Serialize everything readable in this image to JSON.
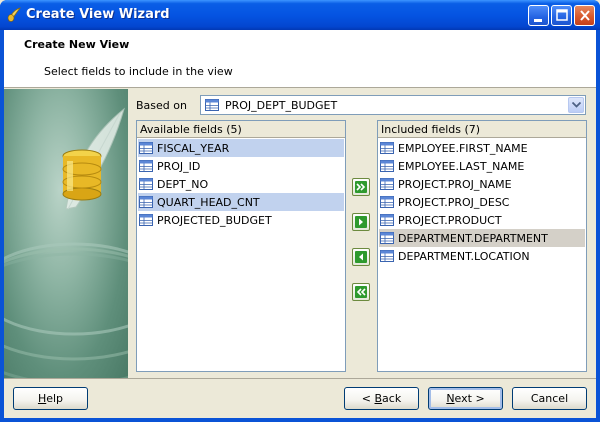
{
  "window": {
    "title": "Create View Wizard"
  },
  "header": {
    "title": "Create New View",
    "subtitle": "Select fields to include in the view"
  },
  "based_on": {
    "label": "Based on",
    "value": "PROJ_DEPT_BUDGET"
  },
  "available": {
    "header": "Available fields (5)",
    "items": [
      {
        "label": "FISCAL_YEAR",
        "selected": true
      },
      {
        "label": "PROJ_ID",
        "selected": false
      },
      {
        "label": "DEPT_NO",
        "selected": false
      },
      {
        "label": "QUART_HEAD_CNT",
        "selected": true
      },
      {
        "label": "PROJECTED_BUDGET",
        "selected": false
      }
    ]
  },
  "included": {
    "header": "Included fields (7)",
    "items": [
      {
        "label": "EMPLOYEE.FIRST_NAME",
        "selected": false
      },
      {
        "label": "EMPLOYEE.LAST_NAME",
        "selected": false
      },
      {
        "label": "PROJECT.PROJ_NAME",
        "selected": false
      },
      {
        "label": "PROJECT.PROJ_DESC",
        "selected": false
      },
      {
        "label": "PROJECT.PRODUCT",
        "selected": false
      },
      {
        "label": "DEPARTMENT.DEPARTMENT",
        "selected": true
      },
      {
        "label": "DEPARTMENT.LOCATION",
        "selected": false
      }
    ]
  },
  "buttons": {
    "help_first": "H",
    "help_rest": "elp",
    "back_arrow": "< ",
    "back_first": "B",
    "back_rest": "ack",
    "next_first": "N",
    "next_rest": "ext >",
    "cancel": "Cancel"
  },
  "icons": {
    "field": "table-field-icon",
    "move_all_right": "move-all-right-icon",
    "move_right": "move-right-icon",
    "move_left": "move-left-icon",
    "move_all_left": "move-all-left-icon"
  },
  "colors": {
    "titlebar": "#0554e2",
    "selection": "#c1d2ee",
    "selection_inactive": "#d4d0c8",
    "move_button_green": "#2e9a2e"
  }
}
